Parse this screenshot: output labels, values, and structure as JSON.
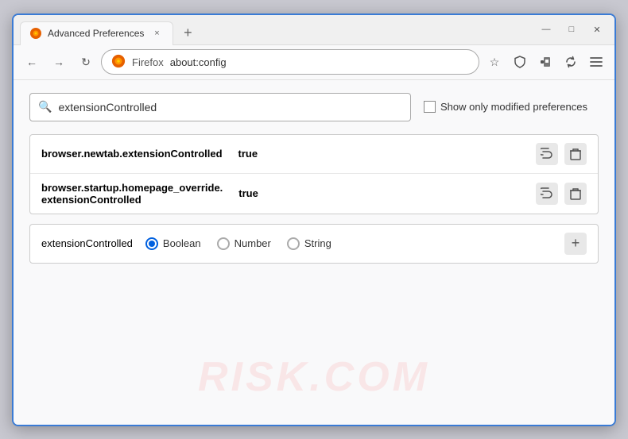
{
  "window": {
    "title": "Advanced Preferences",
    "tab_close": "×",
    "new_tab": "+"
  },
  "controls": {
    "minimize": "—",
    "restore": "□",
    "close": "✕"
  },
  "nav": {
    "back": "←",
    "forward": "→",
    "reload": "↻",
    "site_name": "Firefox",
    "url": "about:config",
    "bookmark": "☆",
    "shield": "⛨",
    "extension": "🧩",
    "sync": "↻",
    "menu": "≡"
  },
  "search": {
    "value": "extensionControlled",
    "placeholder": "extensionControlled",
    "checkbox_label": "Show only modified preferences"
  },
  "results": [
    {
      "name": "browser.newtab.extensionControlled",
      "value": "true"
    },
    {
      "name": "browser.startup.homepage_override.\nextensionControlled",
      "name_line1": "browser.startup.homepage_override.",
      "name_line2": "extensionControlled",
      "value": "true",
      "multiline": true
    }
  ],
  "add_row": {
    "name": "extensionControlled",
    "types": [
      {
        "id": "boolean",
        "label": "Boolean",
        "selected": true
      },
      {
        "id": "number",
        "label": "Number",
        "selected": false
      },
      {
        "id": "string",
        "label": "String",
        "selected": false
      }
    ],
    "add_label": "+"
  },
  "watermark": "RISK.COM",
  "icons": {
    "search": "🔍",
    "reset": "⇄",
    "delete": "🗑",
    "plus": "+"
  }
}
